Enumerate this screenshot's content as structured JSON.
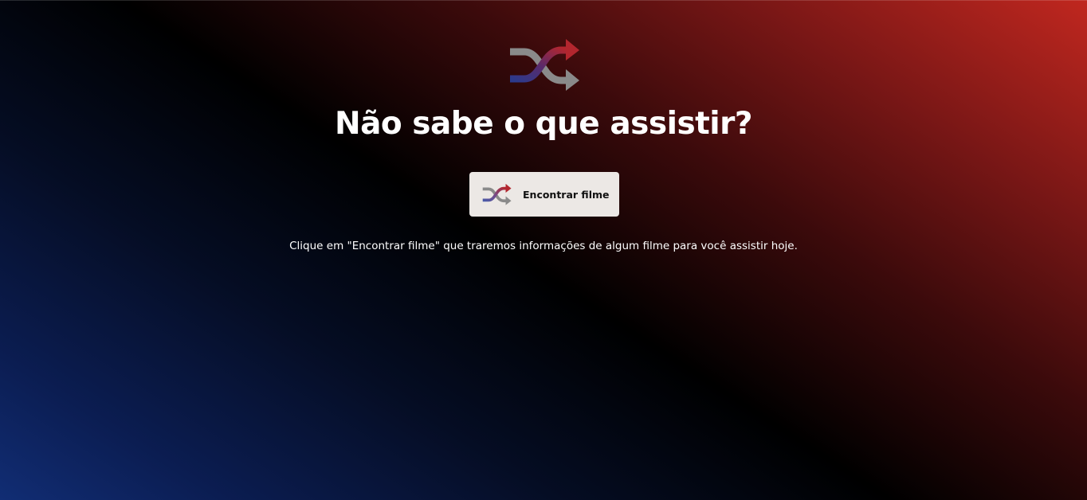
{
  "page": {
    "heading": "Não sabe o que assistir?",
    "find_button": {
      "label": "Encontrar filme",
      "icon": "shuffle-icon"
    },
    "hint": "Clique em \"Encontrar filme\" que traremos informações de algum filme para você assistir hoje.",
    "logo_icon": "shuffle-icon"
  },
  "colors": {
    "background_top_right": "#c0271f",
    "background_center": "#000000",
    "background_bottom_left": "#112d74",
    "button_background": "#ece8e5",
    "shuffle_red": "#b3262e",
    "shuffle_blue": "#2b3a8c",
    "shuffle_gray": "#8a8a8a"
  }
}
